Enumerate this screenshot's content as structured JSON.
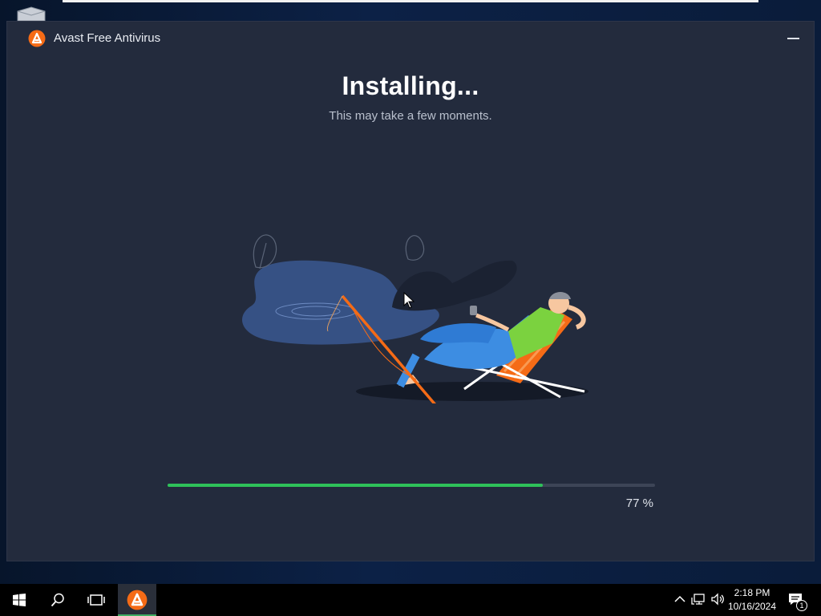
{
  "window": {
    "title": "Avast Free Antivirus"
  },
  "install": {
    "heading": "Installing...",
    "subheading": "This may take a few moments.",
    "progress_fraction": 0.77,
    "progress_label": "77 %"
  },
  "taskbar": {
    "time": "2:18 PM",
    "date": "10/16/2024",
    "notification_count": "1",
    "pinned": [
      "start-icon",
      "search-icon",
      "task-view-icon",
      "avast-icon"
    ]
  },
  "colors": {
    "window_bg": "#232b3d",
    "accent_progress": "#2ec15a",
    "avast_orange": "#f56b16"
  }
}
